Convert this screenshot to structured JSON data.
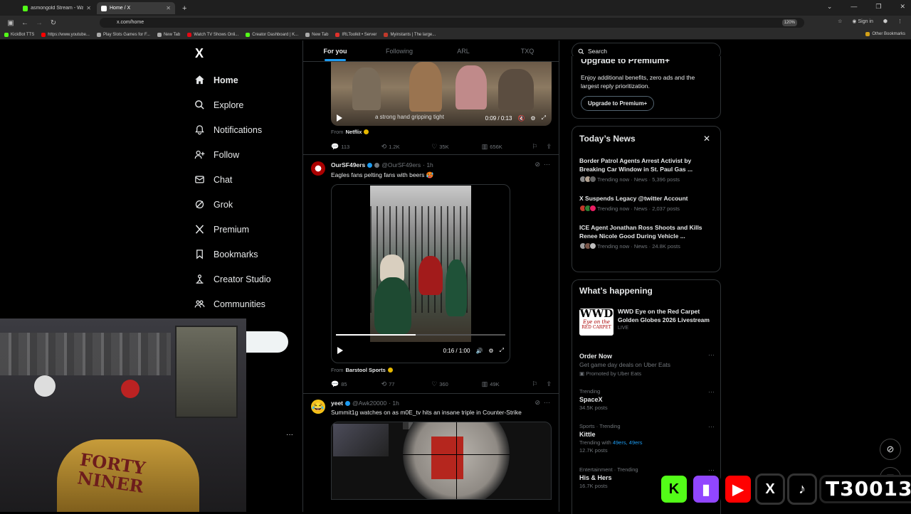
{
  "browser": {
    "tabs": [
      {
        "title": "asmongold Stream - Watch Liv",
        "active": false,
        "favicon_color": "#53fc18"
      },
      {
        "title": "Home / X",
        "active": true,
        "favicon_color": "#ffffff"
      }
    ],
    "new_tab": "+",
    "url": "x.com/home",
    "zoom": "120%",
    "sign_in": "Sign in",
    "bookmarks": [
      {
        "label": "KickBot TTS",
        "color": "#53fc18"
      },
      {
        "label": "https://www.youtube...",
        "color": "#ff0000"
      },
      {
        "label": "Play Slots Games for F...",
        "color": "#aaaaaa"
      },
      {
        "label": "New Tab",
        "color": "#aaaaaa"
      },
      {
        "label": "Watch TV Shows Onli...",
        "color": "#e50914"
      },
      {
        "label": "Creator Dashboard | K...",
        "color": "#53fc18"
      },
      {
        "label": "New Tab",
        "color": "#aaaaaa"
      },
      {
        "label": "IRLToolkit • Server",
        "color": "#e0312b"
      },
      {
        "label": "Myinstants | The large...",
        "color": "#c0392b"
      }
    ],
    "other_bookmarks": "Other Bookmarks"
  },
  "sidebar": {
    "logo": "X",
    "items": [
      {
        "label": "Home",
        "icon": "home-icon",
        "active": true
      },
      {
        "label": "Explore",
        "icon": "search-icon",
        "active": false
      },
      {
        "label": "Notifications",
        "icon": "bell-icon",
        "active": false
      },
      {
        "label": "Follow",
        "icon": "follow-icon",
        "active": false
      },
      {
        "label": "Chat",
        "icon": "mail-icon",
        "active": false
      },
      {
        "label": "Grok",
        "icon": "grok-icon",
        "active": false
      },
      {
        "label": "Premium",
        "icon": "x-icon",
        "active": false
      },
      {
        "label": "Bookmarks",
        "icon": "bookmark-icon",
        "active": false
      },
      {
        "label": "Creator Studio",
        "icon": "creator-icon",
        "active": false
      },
      {
        "label": "Communities",
        "icon": "communities-icon",
        "active": false
      }
    ],
    "more": "···"
  },
  "feed": {
    "tabs": [
      "For you",
      "Following",
      "ARL",
      "TXQ"
    ],
    "post1": {
      "video_caption": "a strong hand gripping tight",
      "time": "0:09 / 0:13",
      "from_label": "From",
      "from_source": "Netflix",
      "replies": "113",
      "reposts": "1.2K",
      "likes": "35K",
      "views": "656K"
    },
    "post2": {
      "name": "OurSF49ers",
      "handle": "@OurSF49ers",
      "time": "· 1h",
      "text": "Eagles fans pelting fans with beers 🥵",
      "video_time": "0:16 / 1:00",
      "progress": 0.47,
      "from_label": "From",
      "from_source": "Barstool Sports",
      "replies": "85",
      "reposts": "77",
      "likes": "360",
      "views": "49K"
    },
    "post3": {
      "name": "yeet",
      "handle": "@Awk20000",
      "time": "· 1h",
      "text": "Summit1g watches on as m0E_tv hits an insane triple in Counter-Strike"
    }
  },
  "right": {
    "search_placeholder": "Search",
    "premium": {
      "title": "Upgrade to Premium+",
      "desc": "Enjoy additional benefits, zero ads and the largest reply prioritization.",
      "button": "Upgrade to Premium+"
    },
    "news": {
      "title": "Today’s News",
      "items": [
        {
          "title": "Border Patrol Agents Arrest Activist by Breaking Car Window in St. Paul Gas ...",
          "meta": "Trending now · News · 5,396 posts"
        },
        {
          "title": "X Suspends Legacy @twitter Account",
          "meta": "Trending now · News · 2,037 posts"
        },
        {
          "title": "ICE Agent Jonathan Ross Shoots and Kills Renee Nicole Good During Vehicle ...",
          "meta": "Trending now · News · 24.8K posts"
        }
      ]
    },
    "happening": {
      "title": "What’s happening",
      "event": {
        "logo_line1": "WWD",
        "logo_line2": "Eye on the",
        "logo_line3": "RED CARPET",
        "title": "WWD Eye on the Red Carpet Golden Globes 2026 Livestream",
        "status": "LIVE"
      },
      "promo": {
        "title": "Order Now",
        "desc": "Get game day deals on Uber Eats",
        "promoted": "Promoted by Uber Eats"
      },
      "trends": [
        {
          "meta": "Trending",
          "title": "SpaceX",
          "posts": "34.5K posts"
        },
        {
          "meta": "Sports · Trending",
          "title": "Kittle",
          "with_label": "Trending with",
          "with": "49ers, 49ers",
          "posts": "12.7K posts"
        },
        {
          "meta": "Entertainment · Trending",
          "title": "His & Hers",
          "posts": "16.7K posts"
        }
      ]
    }
  },
  "overlay": {
    "chair_text": "FORTY NINER",
    "handle": "T30013",
    "socials": [
      {
        "name": "kick-logo",
        "glyph": "K",
        "color": "#53fc18"
      },
      {
        "name": "twitch-logo",
        "glyph": "▮",
        "color": "#9146ff"
      },
      {
        "name": "youtube-logo",
        "glyph": "▶",
        "color": "#ff0000"
      },
      {
        "name": "x-logo",
        "glyph": "X",
        "color": "#000000"
      },
      {
        "name": "tiktok-logo",
        "glyph": "♪",
        "color": "#000000"
      }
    ]
  }
}
